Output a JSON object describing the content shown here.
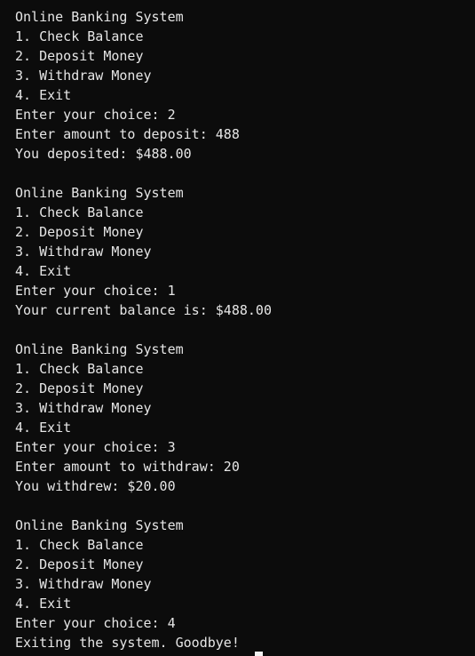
{
  "terminal": {
    "lines": [
      "Online Banking System",
      "1. Check Balance",
      "2. Deposit Money",
      "3. Withdraw Money",
      "4. Exit",
      "Enter your choice: 2",
      "Enter amount to deposit: 488",
      "You deposited: $488.00",
      "",
      "Online Banking System",
      "1. Check Balance",
      "2. Deposit Money",
      "3. Withdraw Money",
      "4. Exit",
      "Enter your choice: 1",
      "Your current balance is: $488.00",
      "",
      "Online Banking System",
      "1. Check Balance",
      "2. Deposit Money",
      "3. Withdraw Money",
      "4. Exit",
      "Enter your choice: 3",
      "Enter amount to withdraw: 20",
      "You withdrew: $20.00",
      "",
      "Online Banking System",
      "1. Check Balance",
      "2. Deposit Money",
      "3. Withdraw Money",
      "4. Exit",
      "Enter your choice: 4",
      "Exiting the system. Goodbye!"
    ],
    "colors": {
      "background": "#0c0c0c",
      "text": "#e6e6e6",
      "cursor": "#f2f2f2"
    }
  }
}
